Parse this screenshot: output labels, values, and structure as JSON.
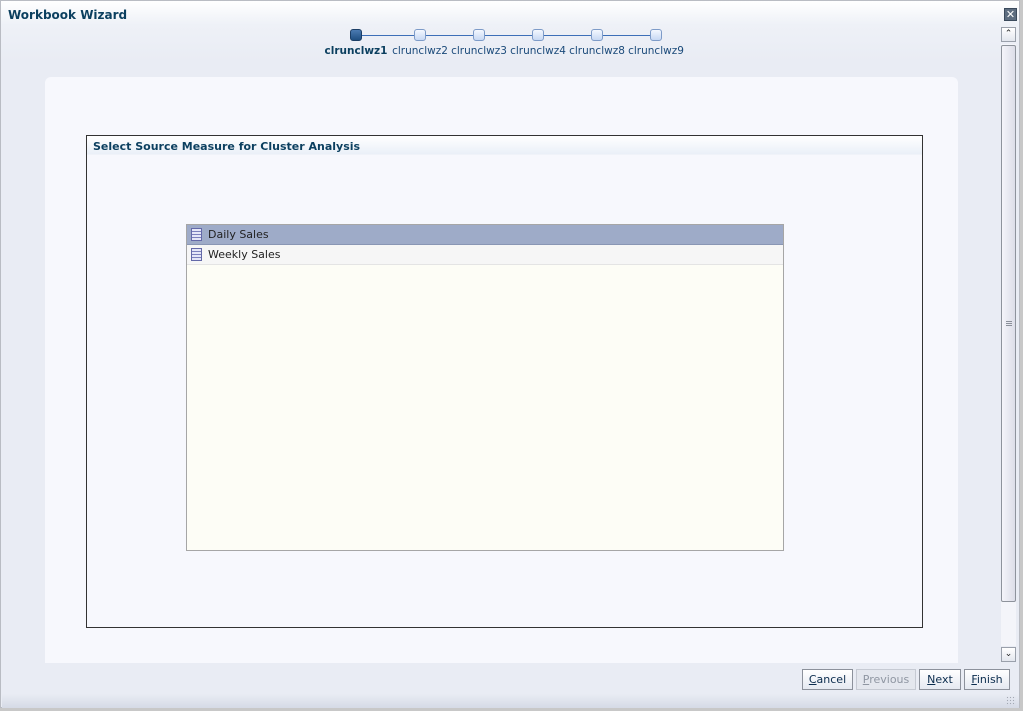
{
  "window": {
    "title": "Workbook Wizard",
    "close_icon": "close-icon"
  },
  "train": {
    "steps": [
      {
        "label": "clrunclwz1",
        "active": true
      },
      {
        "label": "clrunclwz2",
        "active": false
      },
      {
        "label": "clrunclwz3",
        "active": false
      },
      {
        "label": "clrunclwz4",
        "active": false
      },
      {
        "label": "clrunclwz8",
        "active": false
      },
      {
        "label": "clrunclwz9",
        "active": false
      }
    ]
  },
  "content": {
    "section_title": "Select Source Measure for Cluster Analysis",
    "measures": [
      {
        "label": "Daily Sales",
        "icon": "measure-icon",
        "selected": true
      },
      {
        "label": "Weekly Sales",
        "icon": "measure-icon",
        "selected": false
      }
    ]
  },
  "scrollbar": {
    "up_glyph": "⌃",
    "down_glyph": "⌄"
  },
  "footer": {
    "buttons": [
      {
        "id": "cancel",
        "mnemonic": "C",
        "rest": "ancel",
        "enabled": true
      },
      {
        "id": "previous",
        "mnemonic": "P",
        "rest": "revious",
        "enabled": false
      },
      {
        "id": "next",
        "mnemonic": "N",
        "rest": "ext",
        "enabled": true
      },
      {
        "id": "finish",
        "mnemonic": "F",
        "rest": "inish",
        "enabled": true
      }
    ]
  }
}
